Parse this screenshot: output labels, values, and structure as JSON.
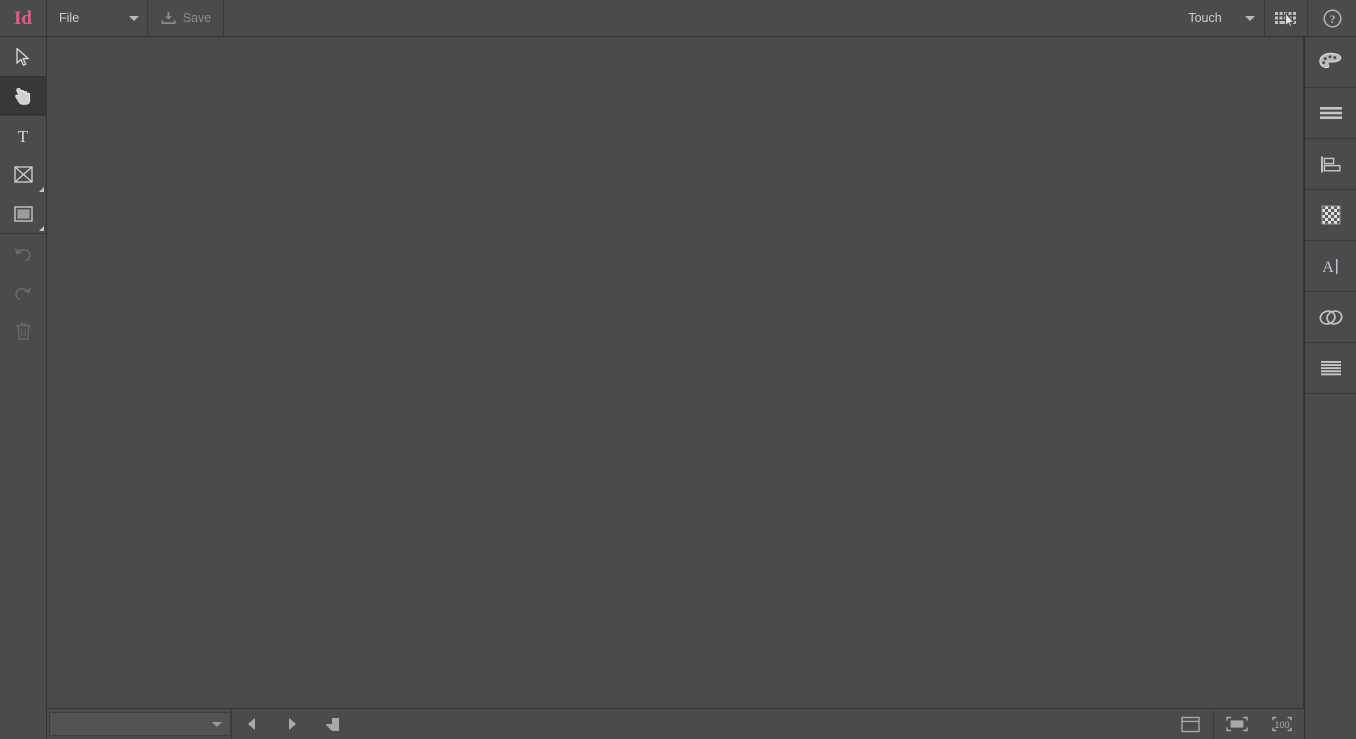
{
  "app": {
    "name": "Id",
    "brand_color": "#e05c8a",
    "workspace": "Touch",
    "chrome_color": "#4b4b4b",
    "canvas_color": "#4a4a4a"
  },
  "header": {
    "logo_label": "Id",
    "file_menu_label": "File",
    "file_menu_caret_icon": "chevron-down-icon",
    "save_label": "Save",
    "save_icon": "save-download-icon",
    "save_enabled": false,
    "workspace_label": "Touch",
    "workspace_caret_icon": "chevron-down-icon",
    "input_mode_icon": "keyboard-cursor-icon",
    "help_icon": "help-circle-icon"
  },
  "toolbar": {
    "groups": [
      {
        "name": "selection",
        "items": [
          {
            "label": "Selection Tool",
            "icon": "cursor-arrow-icon",
            "selected": false,
            "disabled": false,
            "has_flyout": false
          },
          {
            "label": "Touch Gesture Tool",
            "icon": "hand-pointer-icon",
            "selected": true,
            "disabled": false,
            "has_flyout": false
          }
        ]
      },
      {
        "name": "content",
        "items": [
          {
            "label": "Type Tool",
            "icon": "type-t-icon",
            "selected": false,
            "disabled": false,
            "has_flyout": false
          },
          {
            "label": "Frame Tool",
            "icon": "graphic-frame-icon",
            "selected": false,
            "disabled": false,
            "has_flyout": true
          },
          {
            "label": "Rectangle Tool",
            "icon": "rectangle-icon",
            "selected": false,
            "disabled": false,
            "has_flyout": true
          }
        ]
      },
      {
        "name": "history",
        "items": [
          {
            "label": "Undo",
            "icon": "undo-arrow-icon",
            "selected": false,
            "disabled": true,
            "has_flyout": false
          },
          {
            "label": "Redo",
            "icon": "redo-arrow-icon",
            "selected": false,
            "disabled": true,
            "has_flyout": false
          },
          {
            "label": "Delete",
            "icon": "trash-icon",
            "selected": false,
            "disabled": true,
            "has_flyout": false
          }
        ]
      }
    ]
  },
  "canvas": {
    "document_open": false,
    "background": "#4a4a4a"
  },
  "statusbar": {
    "page_combo_value": "",
    "page_combo_caret_icon": "chevron-down-icon",
    "previous_page_icon": "triangle-left-icon",
    "previous_page_label": "Previous Page",
    "next_page_icon": "triangle-right-icon",
    "next_page_label": "Next Page",
    "page_layout_icon": "page-spread-icon",
    "page_layout_label": "Page Layout",
    "right_buttons": [
      {
        "label": "Screen Mode",
        "icon": "window-frame-icon"
      },
      {
        "label": "Preview Mode",
        "icon": "dashed-rectangle-icon"
      },
      {
        "label": "Zoom Level",
        "icon": "bracket-100-icon"
      }
    ]
  },
  "rail": {
    "items": [
      {
        "label": "Color",
        "icon": "color-palette-icon"
      },
      {
        "label": "Paragraph Styles",
        "icon": "lines-stack-icon"
      },
      {
        "label": "Align",
        "icon": "align-left-icon"
      },
      {
        "label": "Effects",
        "icon": "transparency-checker-icon"
      },
      {
        "label": "Character",
        "icon": "text-caret-a-icon"
      },
      {
        "label": "Creative Cloud Libraries",
        "icon": "creative-cloud-icon"
      },
      {
        "label": "Layers",
        "icon": "lines-list-icon"
      }
    ]
  }
}
